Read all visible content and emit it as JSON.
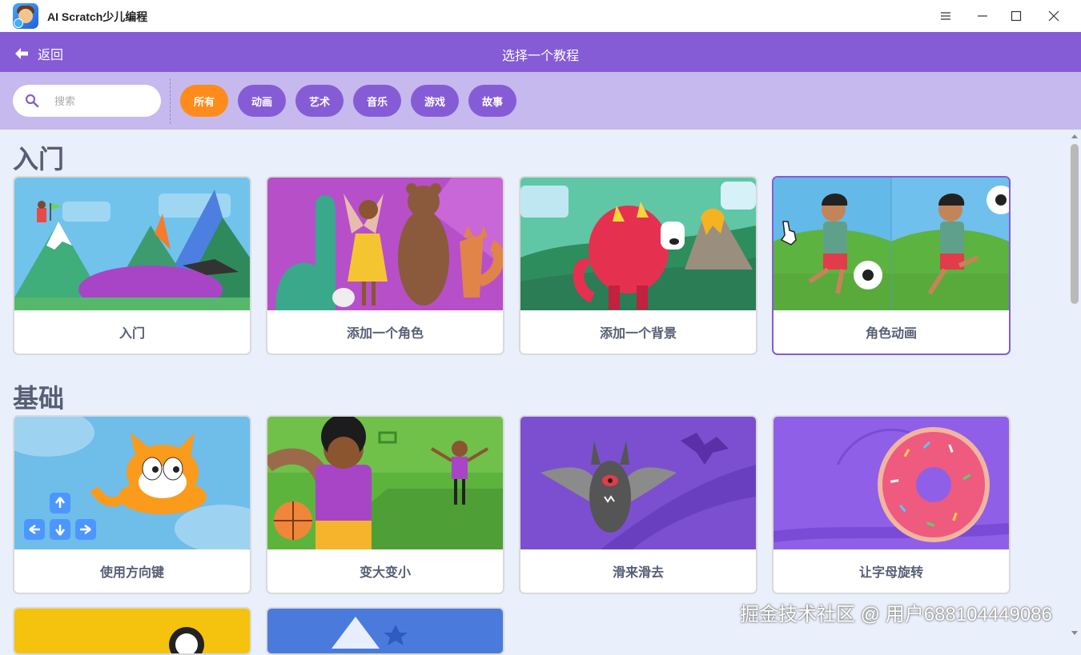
{
  "window": {
    "title": "AI Scratch少儿编程"
  },
  "header": {
    "back_label": "返回",
    "title": "选择一个教程"
  },
  "search": {
    "placeholder": "搜索",
    "value": ""
  },
  "filters": [
    {
      "label": "所有",
      "active": true
    },
    {
      "label": "动画",
      "active": false
    },
    {
      "label": "艺术",
      "active": false
    },
    {
      "label": "音乐",
      "active": false
    },
    {
      "label": "游戏",
      "active": false
    },
    {
      "label": "故事",
      "active": false
    }
  ],
  "sections": [
    {
      "title": "入门",
      "cards": [
        {
          "label": "入门"
        },
        {
          "label": "添加一个角色"
        },
        {
          "label": "添加一个背景"
        },
        {
          "label": "角色动画"
        }
      ]
    },
    {
      "title": "基础",
      "cards": [
        {
          "label": "使用方向键"
        },
        {
          "label": "变大变小"
        },
        {
          "label": "滑来滑去"
        },
        {
          "label": "让字母旋转"
        }
      ]
    }
  ],
  "colors": {
    "primary": "#855cd6",
    "accent": "#ff8c1a",
    "filterbar": "#c6b9ee",
    "background": "#e9effb",
    "text": "#575e75"
  },
  "watermark": "掘金技术社区 @ 用户688104449086"
}
